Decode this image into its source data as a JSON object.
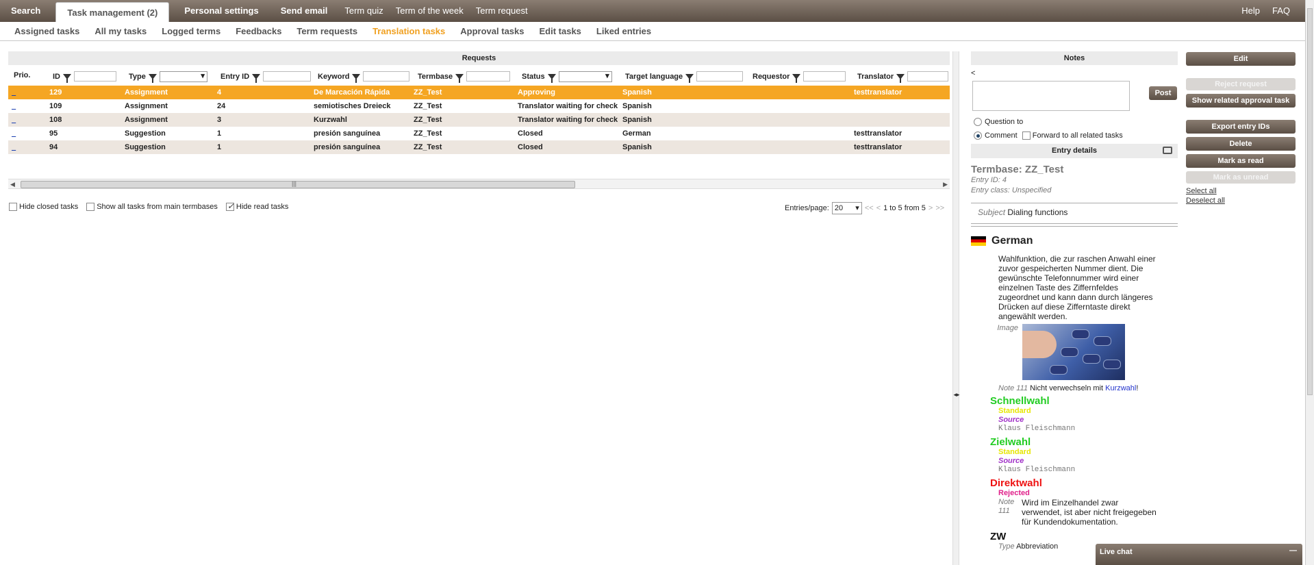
{
  "topnav": {
    "tabs": [
      {
        "label": "Search"
      },
      {
        "label": "Task management (2)"
      },
      {
        "label": "Personal settings"
      },
      {
        "label": "Send email"
      },
      {
        "label": "Term quiz"
      },
      {
        "label": "Term of the week"
      },
      {
        "label": "Term request"
      }
    ],
    "help": "Help",
    "faq": "FAQ"
  },
  "subnav": {
    "items": [
      {
        "label": "Assigned tasks"
      },
      {
        "label": "All my tasks"
      },
      {
        "label": "Logged terms"
      },
      {
        "label": "Feedbacks"
      },
      {
        "label": "Term requests"
      },
      {
        "label": "Translation tasks"
      },
      {
        "label": "Approval tasks"
      },
      {
        "label": "Edit tasks"
      },
      {
        "label": "Liked entries"
      }
    ],
    "active": "Translation tasks"
  },
  "requests": {
    "title": "Requests",
    "columns": [
      "Prio.",
      "ID",
      "Type",
      "Entry ID",
      "Keyword",
      "Termbase",
      "Status",
      "Target language",
      "Requestor",
      "Translator"
    ],
    "rows": [
      {
        "prio": "_",
        "id": "129",
        "type": "Assignment",
        "entry_id": "4",
        "keyword": "De Marcación Rápida",
        "termbase": "ZZ_Test",
        "status": "Approving",
        "target": "Spanish",
        "requestor": "",
        "translator": "testtranslator"
      },
      {
        "prio": "_",
        "id": "109",
        "type": "Assignment",
        "entry_id": "24",
        "keyword": "semiotisches Dreieck",
        "termbase": "ZZ_Test",
        "status": "Translator waiting for check",
        "target": "Spanish",
        "requestor": "",
        "translator": ""
      },
      {
        "prio": "_",
        "id": "108",
        "type": "Assignment",
        "entry_id": "3",
        "keyword": "Kurzwahl",
        "termbase": "ZZ_Test",
        "status": "Translator waiting for check",
        "target": "Spanish",
        "requestor": "",
        "translator": ""
      },
      {
        "prio": "_",
        "id": "95",
        "type": "Suggestion",
        "entry_id": "1",
        "keyword": "presión sanguínea",
        "termbase": "ZZ_Test",
        "status": "Closed",
        "target": "German",
        "requestor": "",
        "translator": "testtranslator"
      },
      {
        "prio": "_",
        "id": "94",
        "type": "Suggestion",
        "entry_id": "1",
        "keyword": "presión sanguínea",
        "termbase": "ZZ_Test",
        "status": "Closed",
        "target": "Spanish",
        "requestor": "",
        "translator": "testtranslator"
      }
    ],
    "scroll_grip": "|||"
  },
  "options": {
    "hide_closed": "Hide closed tasks",
    "show_all": "Show all tasks from main termbases",
    "hide_read": "Hide read tasks"
  },
  "pager": {
    "label": "Entries/page:",
    "value": "20",
    "first": "<<",
    "prev": "<",
    "range": "1 to 5 from 5",
    "next": ">",
    "last": ">>"
  },
  "notes": {
    "title": "Notes",
    "back": "<",
    "post": "Post",
    "question_to": "Question to",
    "comment": "Comment",
    "forward": "Forward to all related tasks"
  },
  "entry": {
    "title": "Entry details",
    "termbase": "Termbase: ZZ_Test",
    "entry_id": "Entry ID: 4",
    "entry_class": "Entry class: Unspecified",
    "subject_label": "Subject",
    "subject_value": "Dialing functions",
    "language": "German",
    "definition": "Wahlfunktion, die zur raschen Anwahl einer zuvor gespeicherten Nummer dient. Die gewünschte Telefonnummer wird einer einzelnen Taste des Ziffernfeldes zugeordnet und kann dann durch längeres Drücken auf diese Zifferntaste direkt angewählt werden.",
    "image_label": "Image",
    "note_label": "Note 111",
    "note_text": "Nicht verwechseln mit",
    "note_link": "Kurzwahl",
    "note_end": "!",
    "terms": [
      {
        "term": "Schnellwahl",
        "color": "#22cc22",
        "status": "Standard",
        "status_color": "#e6e600",
        "source_label": "Source",
        "source": "Klaus Fleischmann"
      },
      {
        "term": "Zielwahl",
        "color": "#22cc22",
        "status": "Standard",
        "status_color": "#e6e600",
        "source_label": "Source",
        "source": "Klaus Fleischmann"
      },
      {
        "term": "Direktwahl",
        "color": "#ee1111",
        "status": "Rejected",
        "status_color": "#e0208a",
        "note_label": "Note 111",
        "note": "Wird im Einzelhandel zwar verwendet, ist aber nicht freigegeben für Kundendokumentation."
      },
      {
        "term": "ZW",
        "color": "#111111",
        "type_label": "Type",
        "type": "Abbreviation"
      }
    ],
    "source_color": "#a030c8"
  },
  "actions": {
    "edit": "Edit",
    "reject": "Reject request",
    "show_related": "Show related approval task",
    "export": "Export entry IDs",
    "delete": "Delete",
    "mark_read": "Mark as read",
    "mark_unread": "Mark as unread",
    "select_all": "Select all",
    "deselect_all": "Deselect all"
  },
  "livechat": {
    "title": "Live chat",
    "minimize": "—"
  },
  "colors": {
    "accent": "#f5a623",
    "nav_dark": "#5b4f45",
    "row_alt": "#ede6df"
  }
}
